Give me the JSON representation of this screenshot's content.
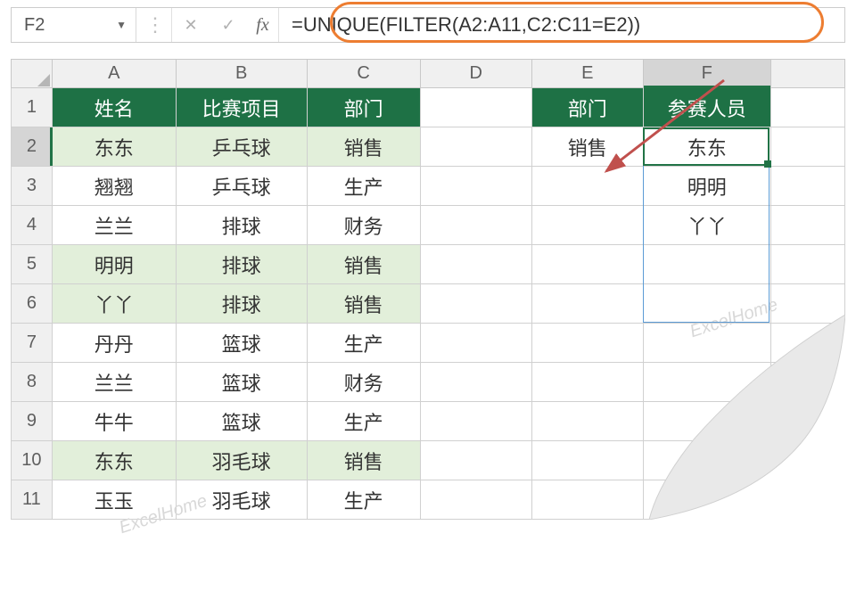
{
  "namebox": {
    "value": "F2"
  },
  "formula_bar": {
    "fx_label": "fx",
    "formula": "=UNIQUE(FILTER(A2:A11,C2:C11=E2))"
  },
  "columns": [
    "A",
    "B",
    "C",
    "D",
    "E",
    "F"
  ],
  "headers": {
    "A": "姓名",
    "B": "比赛项目",
    "C": "部门",
    "E": "部门",
    "F": "参赛人员"
  },
  "rows": [
    {
      "num": 1
    },
    {
      "num": 2,
      "A": "东东",
      "B": "乒乓球",
      "C": "销售",
      "E": "销售",
      "F": "东东",
      "hl": true
    },
    {
      "num": 3,
      "A": "翘翘",
      "B": "乒乓球",
      "C": "生产",
      "F": "明明"
    },
    {
      "num": 4,
      "A": "兰兰",
      "B": "排球",
      "C": "财务",
      "F": "丫丫"
    },
    {
      "num": 5,
      "A": "明明",
      "B": "排球",
      "C": "销售",
      "hl": true
    },
    {
      "num": 6,
      "A": "丫丫",
      "B": "排球",
      "C": "销售",
      "hl": true
    },
    {
      "num": 7,
      "A": "丹丹",
      "B": "篮球",
      "C": "生产"
    },
    {
      "num": 8,
      "A": "兰兰",
      "B": "篮球",
      "C": "财务"
    },
    {
      "num": 9,
      "A": "牛牛",
      "B": "篮球",
      "C": "生产"
    },
    {
      "num": 10,
      "A": "东东",
      "B": "羽毛球",
      "C": "销售",
      "hl": true
    },
    {
      "num": 11,
      "A": "玉玉",
      "B": "羽毛球",
      "C": "生产"
    }
  ],
  "active_cell": "F2",
  "watermark": "ExcelHome"
}
